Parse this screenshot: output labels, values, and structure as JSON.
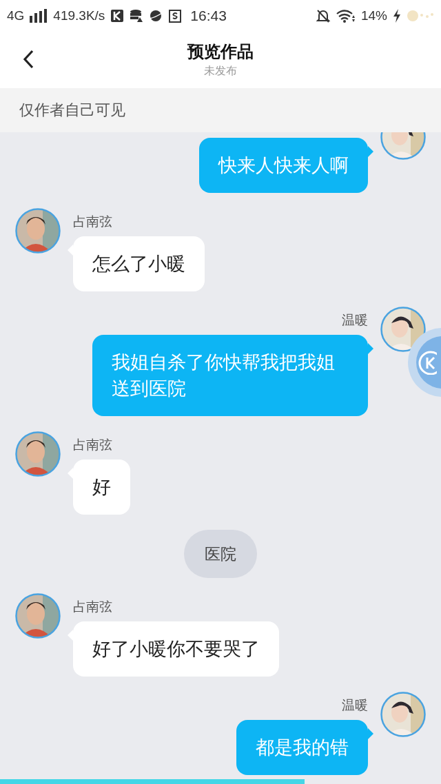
{
  "status_bar": {
    "network": "4G",
    "speed": "419.3K/s",
    "time": "16:43",
    "battery": "14%"
  },
  "header": {
    "title": "预览作品",
    "subtitle": "未发布"
  },
  "notice": "仅作者自己可见",
  "messages": [
    {
      "kind": "right",
      "text": "快来人快来人啊"
    },
    {
      "kind": "left",
      "name": "占南弦",
      "text": "怎么了小暖"
    },
    {
      "kind": "right",
      "name": "温暖",
      "text": "我姐自杀了你快帮我把我姐送到医院"
    },
    {
      "kind": "left",
      "name": "占南弦",
      "text": "好"
    },
    {
      "kind": "center",
      "text": "医院"
    },
    {
      "kind": "left",
      "name": "占南弦",
      "text": "好了小暖你不要哭了"
    },
    {
      "kind": "right",
      "name": "温暖",
      "text": "都是我的错"
    }
  ],
  "progress": {
    "level": 0.69
  }
}
